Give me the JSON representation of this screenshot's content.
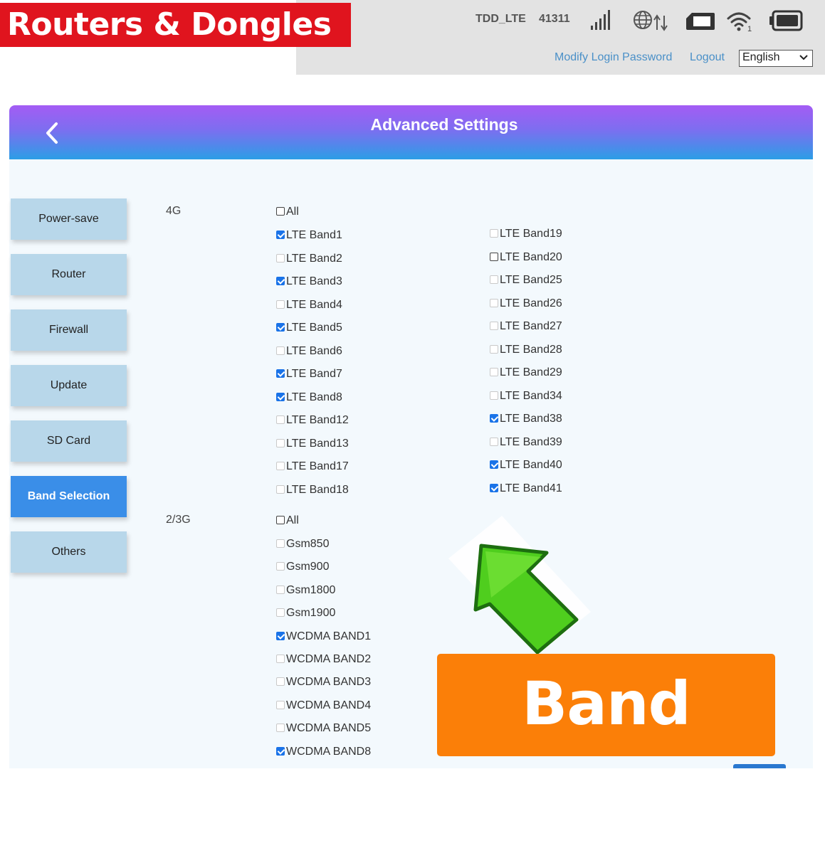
{
  "brand": {
    "title": "Routers & Dongles SL"
  },
  "status": {
    "network_type": "TDD_LTE",
    "operator_code": "41311"
  },
  "header_links": {
    "modify_password": "Modify Login Password",
    "logout": "Logout"
  },
  "language": {
    "selected": "English"
  },
  "page": {
    "title": "Advanced Settings"
  },
  "sidebar": {
    "items": [
      {
        "label": "Power-save",
        "active": false
      },
      {
        "label": "Router",
        "active": false
      },
      {
        "label": "Firewall",
        "active": false
      },
      {
        "label": "Update",
        "active": false
      },
      {
        "label": "SD Card",
        "active": false
      },
      {
        "label": "Band Selection",
        "active": true
      },
      {
        "label": "Others",
        "active": false
      }
    ]
  },
  "bands_4g": {
    "label": "4G",
    "all_label": "All",
    "col1": [
      {
        "label": "LTE Band1",
        "checked": true
      },
      {
        "label": "LTE Band2",
        "checked": false
      },
      {
        "label": "LTE Band3",
        "checked": true
      },
      {
        "label": "LTE Band4",
        "checked": false
      },
      {
        "label": "LTE Band5",
        "checked": true
      },
      {
        "label": "LTE Band6",
        "checked": false
      },
      {
        "label": "LTE Band7",
        "checked": true
      },
      {
        "label": "LTE Band8",
        "checked": true
      },
      {
        "label": "LTE Band12",
        "checked": false
      },
      {
        "label": "LTE Band13",
        "checked": false
      },
      {
        "label": "LTE Band17",
        "checked": false
      },
      {
        "label": "LTE Band18",
        "checked": false
      }
    ],
    "col2": [
      {
        "label": "LTE Band19",
        "checked": false
      },
      {
        "label": "LTE Band20",
        "checked": false
      },
      {
        "label": "LTE Band25",
        "checked": false
      },
      {
        "label": "LTE Band26",
        "checked": false
      },
      {
        "label": "LTE Band27",
        "checked": false
      },
      {
        "label": "LTE Band28",
        "checked": false
      },
      {
        "label": "LTE Band29",
        "checked": false
      },
      {
        "label": "LTE Band34",
        "checked": false
      },
      {
        "label": "LTE Band38",
        "checked": true
      },
      {
        "label": "LTE Band39",
        "checked": false
      },
      {
        "label": "LTE Band40",
        "checked": true
      },
      {
        "label": "LTE Band41",
        "checked": true
      }
    ]
  },
  "bands_23g": {
    "label": "2/3G",
    "all_label": "All",
    "items": [
      {
        "label": "Gsm850",
        "checked": false
      },
      {
        "label": "Gsm900",
        "checked": false
      },
      {
        "label": "Gsm1800",
        "checked": false
      },
      {
        "label": "Gsm1900",
        "checked": false
      },
      {
        "label": "WCDMA BAND1",
        "checked": true
      },
      {
        "label": "WCDMA BAND2",
        "checked": false
      },
      {
        "label": "WCDMA BAND3",
        "checked": false
      },
      {
        "label": "WCDMA BAND4",
        "checked": false
      },
      {
        "label": "WCDMA BAND5",
        "checked": false
      },
      {
        "label": "WCDMA BAND8",
        "checked": true
      }
    ]
  },
  "overlay": {
    "banner": "Band Lock"
  },
  "colors": {
    "brand_red": "#e0141e",
    "accent_orange": "#fb7f08",
    "active_blue": "#3a8ee8",
    "arrow_green": "#4fce1e"
  }
}
